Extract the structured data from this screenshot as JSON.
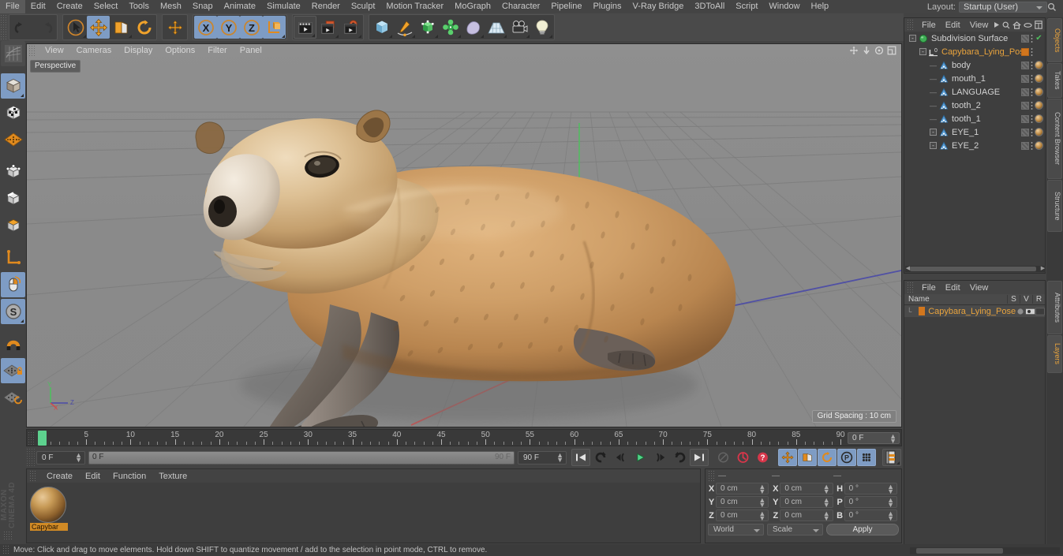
{
  "app": {
    "title": "MAXON CINEMA 4D"
  },
  "menubar": {
    "items": [
      "File",
      "Edit",
      "Create",
      "Select",
      "Tools",
      "Mesh",
      "Snap",
      "Animate",
      "Simulate",
      "Render",
      "Sculpt",
      "Motion Tracker",
      "MoGraph",
      "Character",
      "Pipeline",
      "Plugins",
      "V-Ray Bridge",
      "3DToAll",
      "Script",
      "Window",
      "Help"
    ],
    "layout_label": "Layout:",
    "layout_value": "Startup (User)",
    "search_icon": "search-icon"
  },
  "toolbar": {
    "groups": [
      {
        "name": "undo-redo",
        "buttons": [
          {
            "name": "undo-button",
            "icon": "undo-arrow-icon",
            "state": "off"
          },
          {
            "name": "redo-button",
            "icon": "redo-arrow-icon",
            "state": "disabled"
          }
        ]
      },
      {
        "name": "transform-tools",
        "buttons": [
          {
            "name": "select-tool-button",
            "icon": "cursor-select-icon",
            "state": "off"
          },
          {
            "name": "move-tool-button",
            "icon": "move-arrows-icon",
            "state": "on"
          },
          {
            "name": "scale-tool-button",
            "icon": "scale-box-icon",
            "state": "off"
          },
          {
            "name": "rotate-tool-button",
            "icon": "rotate-circle-icon",
            "state": "off"
          }
        ]
      },
      {
        "name": "world-axis",
        "buttons": [
          {
            "name": "world-axis-button",
            "icon": "move-arrows-icon",
            "state": "off"
          }
        ]
      },
      {
        "name": "axis-locks",
        "buttons": [
          {
            "name": "lock-x-button",
            "icon": "x-axis-icon",
            "label": "X",
            "state": "on"
          },
          {
            "name": "lock-y-button",
            "icon": "y-axis-icon",
            "label": "Y",
            "state": "on"
          },
          {
            "name": "lock-z-button",
            "icon": "z-axis-icon",
            "label": "Z",
            "state": "on"
          },
          {
            "name": "coordinate-system-button",
            "icon": "world-object-axis-icon",
            "state": "on"
          }
        ]
      },
      {
        "name": "render-tools",
        "buttons": [
          {
            "name": "render-view-button",
            "icon": "render-clapper-icon",
            "state": "framed"
          },
          {
            "name": "render-to-picture-viewer-button",
            "icon": "render-picture-icon",
            "state": "off"
          },
          {
            "name": "render-settings-button",
            "icon": "render-settings-icon",
            "state": "off"
          }
        ]
      },
      {
        "name": "create-objects",
        "buttons": [
          {
            "name": "add-cube-button",
            "icon": "cube-icon",
            "state": "off"
          },
          {
            "name": "add-spline-button",
            "icon": "pen-spline-icon",
            "state": "off"
          },
          {
            "name": "add-generator-button",
            "icon": "green-cube-generator-icon",
            "state": "off"
          },
          {
            "name": "add-deformer-button",
            "icon": "green-deformer-icon",
            "state": "off"
          },
          {
            "name": "add-scene-object-button",
            "icon": "environment-icon",
            "state": "off"
          },
          {
            "name": "add-floor-button",
            "icon": "floor-grid-icon",
            "state": "off"
          },
          {
            "name": "add-camera-button",
            "icon": "camera-icon",
            "state": "off"
          },
          {
            "name": "add-light-button",
            "icon": "light-bulb-icon",
            "state": "off"
          }
        ]
      }
    ]
  },
  "left_toolbar": {
    "buttons": [
      {
        "name": "make-editable-button",
        "icon": "make-editable-icon",
        "state": "framed"
      },
      {
        "name": "model-mode-button",
        "icon": "model-cube-icon",
        "state": "on"
      },
      {
        "name": "texture-mode-button",
        "icon": "texture-cube-icon",
        "state": "off"
      },
      {
        "name": "workplane-mode-button",
        "icon": "workplane-grid-icon",
        "state": "off"
      },
      {
        "name": "points-mode-button",
        "icon": "points-cube-icon",
        "state": "off"
      },
      {
        "name": "edges-mode-button",
        "icon": "edges-cube-icon",
        "state": "off"
      },
      {
        "name": "polygons-mode-button",
        "icon": "polygons-cube-icon",
        "state": "off"
      },
      {
        "name": "object-axis-mode-button",
        "icon": "axis-corner-icon",
        "state": "off"
      },
      {
        "name": "viewport-solo-button",
        "icon": "mouse-icon",
        "state": "on"
      },
      {
        "name": "soft-selection-button",
        "icon": "s-circle-icon",
        "state": "on"
      },
      {
        "name": "snap-magnet-button",
        "icon": "magnet-icon",
        "state": "off"
      },
      {
        "name": "lock-workplane-button",
        "icon": "workplane-lock-icon",
        "state": "on"
      },
      {
        "name": "planar-workplane-button",
        "icon": "workplane-rotate-icon",
        "state": "off"
      }
    ]
  },
  "viewport": {
    "menu": [
      "View",
      "Cameras",
      "Display",
      "Options",
      "Filter",
      "Panel"
    ],
    "view_label": "Perspective",
    "grid_spacing": "Grid Spacing : 10 cm",
    "corner_icons": [
      "pan-icon",
      "dolly-icon",
      "orbit-icon",
      "maximize-icon"
    ],
    "axis_labels": {
      "y": "Y",
      "x": "X",
      "z": "Z"
    },
    "scene_object": "Capybara_Lying_Pose"
  },
  "timeline": {
    "ticks": [
      0,
      5,
      10,
      15,
      20,
      25,
      30,
      35,
      40,
      45,
      50,
      55,
      60,
      65,
      70,
      75,
      80,
      85,
      90
    ],
    "range_start": 0,
    "range_end": 90,
    "current_frame_field": "0 F",
    "playhead_frame": 0
  },
  "transport": {
    "current_frame": "0 F",
    "preview_min": "0 F",
    "preview_max": "90 F",
    "range_end": "90 F",
    "buttons": [
      {
        "name": "go-to-start-button",
        "icon": "skip-start-icon",
        "state": "plain"
      },
      {
        "name": "play-backwards-step-button",
        "icon": "rewind-loop-icon",
        "state": "plain"
      },
      {
        "name": "previous-frame-button",
        "icon": "step-back-icon",
        "state": "plain"
      },
      {
        "name": "play-button",
        "icon": "play-triangle-icon",
        "state": "plain"
      },
      {
        "name": "next-frame-button",
        "icon": "step-forward-icon",
        "state": "plain"
      },
      {
        "name": "play-forward-loop-button",
        "icon": "forward-loop-icon",
        "state": "plain"
      },
      {
        "name": "go-to-end-button",
        "icon": "skip-end-icon",
        "state": "plain"
      },
      {
        "name": "record-active-objects-button",
        "icon": "key-disabled-icon",
        "state": "disabled"
      },
      {
        "name": "autokeying-button",
        "icon": "autokey-red-icon",
        "state": "plain"
      },
      {
        "name": "keyframe-selection-button",
        "icon": "question-red-icon",
        "state": "plain"
      },
      {
        "name": "record-position-button",
        "icon": "position-arrows-icon",
        "state": "blue"
      },
      {
        "name": "record-scale-button",
        "icon": "scale-key-icon",
        "state": "blue"
      },
      {
        "name": "record-rotation-button",
        "icon": "rotation-key-icon",
        "state": "blue"
      },
      {
        "name": "record-pla-button",
        "icon": "pla-icon",
        "state": "blue"
      },
      {
        "name": "record-parameter-button",
        "icon": "param-dots-icon",
        "state": "blue"
      },
      {
        "name": "keyframe-mode-button",
        "icon": "keyframe-mode-icon",
        "state": "framed"
      }
    ]
  },
  "material_manager": {
    "menu": [
      "Create",
      "Edit",
      "Function",
      "Texture"
    ],
    "materials": [
      {
        "name": "Capybara",
        "label": "Capybar"
      }
    ]
  },
  "coordinates": {
    "headers": [
      "—",
      "—",
      "—"
    ],
    "position": {
      "label_x": "X",
      "label_y": "Y",
      "label_z": "Z",
      "x": "0 cm",
      "y": "0 cm",
      "z": "0 cm"
    },
    "size": {
      "label_x": "X",
      "label_y": "Y",
      "label_z": "Z",
      "x": "0 cm",
      "y": "0 cm",
      "z": "0 cm"
    },
    "rotation": {
      "label_h": "H",
      "label_p": "P",
      "label_b": "B",
      "h": "0 °",
      "p": "0 °",
      "b": "0 °"
    },
    "system_value": "World",
    "mode_value": "Scale",
    "apply_label": "Apply"
  },
  "object_manager": {
    "menu": [
      "File",
      "Edit",
      "View"
    ],
    "header_icons": [
      "play-arrow-icon",
      "search-icon",
      "home-icon",
      "ellipse-icon",
      "layers-icon"
    ],
    "items": [
      {
        "name": "Subdivision Surface",
        "icon": "subdivision-surface-icon",
        "depth": 0,
        "expandable": true,
        "tag": "hatched",
        "check": true,
        "selected": false,
        "material": false
      },
      {
        "name": "Capybara_Lying_Pose",
        "icon": "null-layer-icon",
        "depth": 1,
        "expandable": true,
        "tag": "orange",
        "check": false,
        "selected": true,
        "material": false
      },
      {
        "name": "body",
        "icon": "polygon-object-icon",
        "depth": 2,
        "expandable": false,
        "tag": "hatched",
        "check": false,
        "selected": false,
        "material": true
      },
      {
        "name": "mouth_1",
        "icon": "polygon-object-icon",
        "depth": 2,
        "expandable": false,
        "tag": "hatched",
        "check": false,
        "selected": false,
        "material": true
      },
      {
        "name": "LANGUAGE",
        "icon": "polygon-object-icon",
        "depth": 2,
        "expandable": false,
        "tag": "hatched",
        "check": false,
        "selected": false,
        "material": true
      },
      {
        "name": "tooth_2",
        "icon": "polygon-object-icon",
        "depth": 2,
        "expandable": false,
        "tag": "hatched",
        "check": false,
        "selected": false,
        "material": true
      },
      {
        "name": "tooth_1",
        "icon": "polygon-object-icon",
        "depth": 2,
        "expandable": false,
        "tag": "hatched",
        "check": false,
        "selected": false,
        "material": true
      },
      {
        "name": "EYE_1",
        "icon": "polygon-object-icon",
        "depth": 2,
        "expandable": true,
        "tag": "hatched",
        "check": false,
        "selected": false,
        "material": true
      },
      {
        "name": "EYE_2",
        "icon": "polygon-object-icon",
        "depth": 2,
        "expandable": true,
        "tag": "hatched",
        "check": false,
        "selected": false,
        "material": true
      }
    ]
  },
  "attribute_manager": {
    "menu": [
      "File",
      "Edit",
      "View"
    ],
    "columns": [
      "Name",
      "S",
      "V",
      "R"
    ],
    "rows": [
      {
        "name": "Capybara_Lying_Pose",
        "s": "dot",
        "v": "eye",
        "r": "box"
      }
    ]
  },
  "right_tabs": {
    "upper": [
      "Objects",
      "Takes",
      "Content Browser",
      "Structure"
    ],
    "lower": [
      "Attributes",
      "Layers"
    ],
    "active_upper": "Objects",
    "active_lower": "Layers"
  },
  "statusbar": {
    "message": "Move: Click and drag to move elements. Hold down SHIFT to quantize movement / add to the selection in point mode, CTRL to remove."
  }
}
